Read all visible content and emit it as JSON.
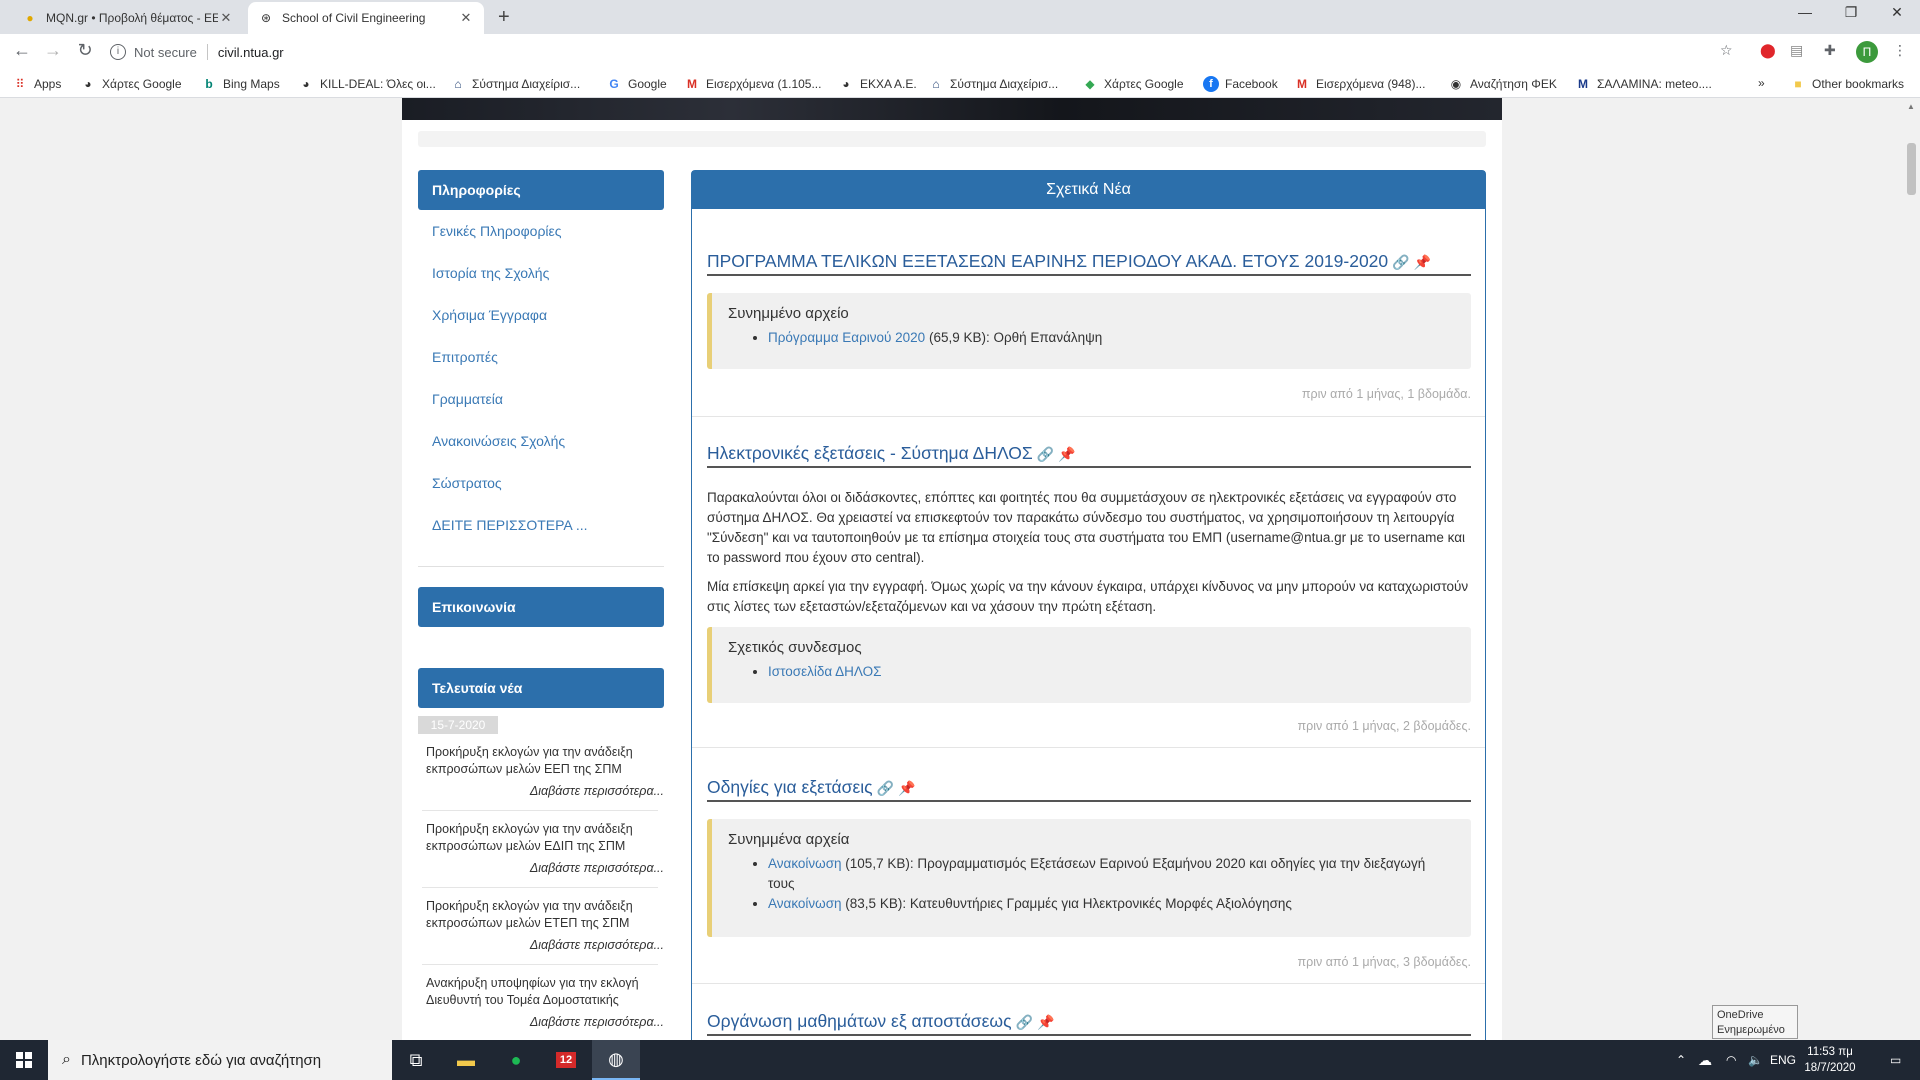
{
  "browser": {
    "tabs": [
      {
        "title": "MQN.gr • Προβολή θέματος - ΕΕ",
        "active": false
      },
      {
        "title": "School of Civil Engineering",
        "active": true
      }
    ],
    "new_tab": "+",
    "security_label": "Not secure",
    "url": "civil.ntua.gr",
    "profile_initial": "Π",
    "bookmarks": [
      {
        "label": "Apps",
        "icon": "apps-grid-icon"
      },
      {
        "label": "Χάρτες Google",
        "icon": "globe-icon"
      },
      {
        "label": "Bing Maps",
        "icon": "bing-icon"
      },
      {
        "label": "KILL-DEAL: Όλες οι...",
        "icon": "globe-icon"
      },
      {
        "label": "Σύστημα Διαχείρισ...",
        "icon": "ntua-icon"
      },
      {
        "label": "Google",
        "icon": "google-icon"
      },
      {
        "label": "Εισερχόμενα (1.105...",
        "icon": "gmail-icon"
      },
      {
        "label": "ΕΚΧΑ Α.Ε.",
        "icon": "globe-icon"
      },
      {
        "label": "Σύστημα Διαχείρισ...",
        "icon": "ntua-icon"
      },
      {
        "label": "Χάρτες Google",
        "icon": "maps-icon"
      },
      {
        "label": "Facebook",
        "icon": "facebook-icon"
      },
      {
        "label": "Εισερχόμενα (948)...",
        "icon": "gmail-icon"
      },
      {
        "label": "Αναζήτηση ΦΕΚ",
        "icon": "fek-icon"
      },
      {
        "label": "ΣΑΛΑΜΙΝΑ: meteo....",
        "icon": "meteo-icon"
      }
    ],
    "bookmarks_overflow": "»",
    "other_bookmarks": "Other bookmarks"
  },
  "sidebar": {
    "info_heading": "Πληροφορίες",
    "info_links": [
      "Γενικές Πληροφορίες",
      "Ιστορία της Σχολής",
      "Χρήσιμα Έγγραφα",
      "Επιτροπές",
      "Γραμματεία",
      "Ανακοινώσεις Σχολής",
      "Σώστρατος",
      "ΔΕΙΤΕ ΠΕΡΙΣΣΟΤΕΡΑ ..."
    ],
    "contact_heading": "Επικοινωνία",
    "news_heading": "Τελευταία νέα",
    "news_date": "15-7-2020",
    "news_items": [
      {
        "text": "Προκήρυξη εκλογών για την ανάδειξη εκπροσώπων μελών ΕΕΠ της ΣΠΜ",
        "more": "Διαβάστε περισσότερα..."
      },
      {
        "text": "Προκήρυξη εκλογών για την ανάδειξη εκπροσώπων μελών ΕΔΙΠ της ΣΠΜ",
        "more": "Διαβάστε περισσότερα..."
      },
      {
        "text": "Προκήρυξη εκλογών για την ανάδειξη εκπροσώπων μελών ΕΤΕΠ της ΣΠΜ",
        "more": "Διαβάστε περισσότερα..."
      },
      {
        "text": "Ανακήρυξη υποψηφίων για την εκλογή Διευθυντή του Τομέα Δομοστατικής",
        "more": "Διαβάστε περισσότερα..."
      }
    ]
  },
  "main": {
    "heading": "Σχετικά Νέα",
    "articles": [
      {
        "title": "ΠΡΟΓΡΑΜΜΑ ΤΕΛΙΚΩΝ ΕΞΕΤΑΣΕΩΝ ΕΑΡΙΝΗΣ ΠΕΡΙΟΔΟΥ ΑΚΑΔ. ΕΤΟΥΣ 2019-2020",
        "box_heading": "Συνημμένο αρχείο",
        "box_items": [
          {
            "link": "Πρόγραμμα Εαρινού 2020",
            "rest": " (65,9 KB): Ορθή Επανάληψη"
          }
        ],
        "meta": "πριν από 1 μήνας, 1 βδομάδα."
      },
      {
        "title": "Ηλεκτρονικές εξετάσεις - Σύστημα ΔΗΛΟΣ",
        "para1": "Παρακαλούνται όλοι οι διδάσκοντες, επόπτες και φοιτητές που θα συμμετάσχουν σε ηλεκτρονικές εξετάσεις να εγγραφούν στο σύστημα ΔΗΛΟΣ. Θα χρειαστεί να επισκεφτούν τον παρακάτω σύνδεσμο του συστήματος, να χρησιμοποιήσουν τη λειτουργία \"Σύνδεση\" και να ταυτοποιηθούν με τα επίσημα στοιχεία τους στα συστήματα του ΕΜΠ (username@ntua.gr με το username και το password που έχουν στο central).",
        "para2": "Μία επίσκεψη αρκεί για την εγγραφή. Όμως χωρίς να την κάνουν έγκαιρα, υπάρχει κίνδυνος να μην μπορούν να καταχωριστούν στις λίστες των εξεταστών/εξεταζόμενων και να χάσουν την πρώτη εξέταση.",
        "box_heading": "Σχετικός συνδεσμος",
        "box_items": [
          {
            "link": "Ιστοσελίδα ΔΗΛΟΣ",
            "rest": ""
          }
        ],
        "meta": "πριν από 1 μήνας, 2 βδομάδες."
      },
      {
        "title": "Οδηγίες για εξετάσεις",
        "box_heading": "Συνημμένα αρχεία",
        "box_items": [
          {
            "link": "Ανακοίνωση",
            "rest": " (105,7 KB): Προγραμματισμός Εξετάσεων Εαρινού Εξαμήνου 2020 και οδηγίες για την διεξαγωγή τους"
          },
          {
            "link": "Ανακοίνωση",
            "rest": " (83,5 KB): Κατευθυντήριες Γραμμές για Ηλεκτρονικές Μορφές Αξιολόγησης"
          }
        ],
        "meta": "πριν από 1 μήνας, 3 βδομάδες."
      },
      {
        "title": "Οργάνωση μαθημάτων εξ αποστάσεως"
      }
    ]
  },
  "tooltip": {
    "line1": "OneDrive",
    "line2": "Ενημερωμένο"
  },
  "taskbar": {
    "search_placeholder": "Πληκτρολογήστε εδώ για αναζήτηση",
    "language": "ENG",
    "time": "11:53 πμ",
    "date": "18/7/2020"
  },
  "colors": {
    "header_blue": "#2c6fab",
    "link_blue": "#3a79b5",
    "attachment_accent": "#e8cf77"
  }
}
